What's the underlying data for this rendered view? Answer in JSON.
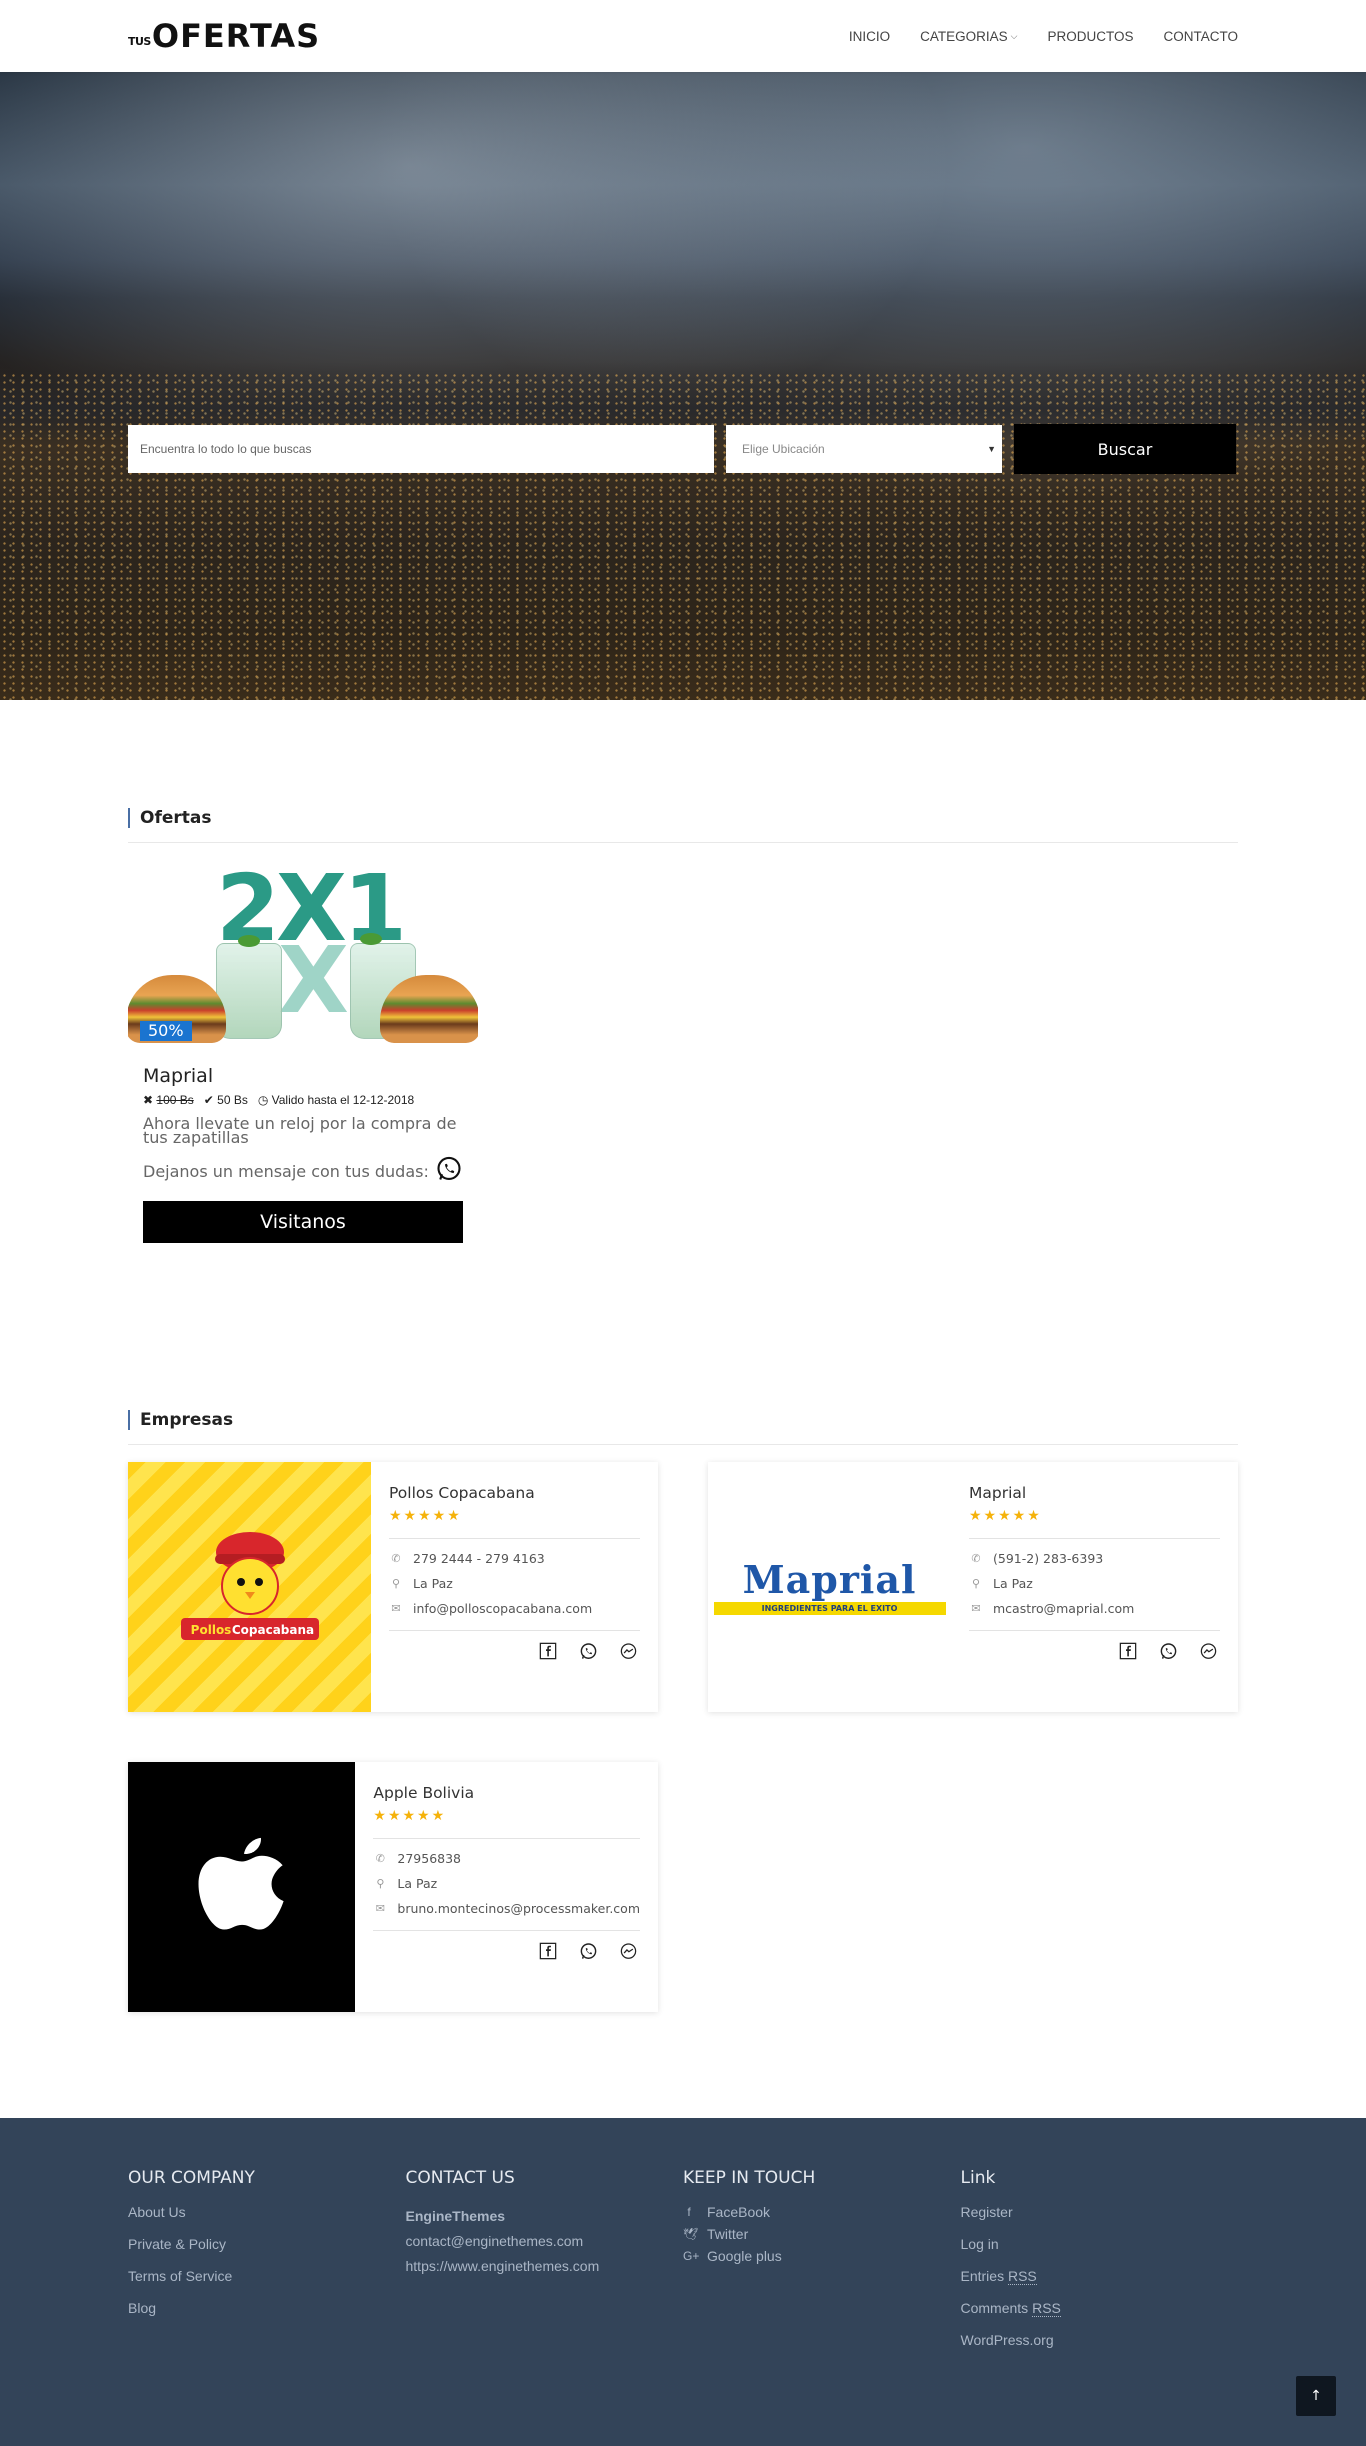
{
  "header": {
    "logo_small": "TUS",
    "logo_big": "OFERTAS",
    "nav": [
      "INICIO",
      "CATEGORIAS",
      "PRODUCTOS",
      "CONTACTO"
    ]
  },
  "search": {
    "placeholder": "Encuentra lo todo lo que buscas",
    "location_placeholder": "Elige Ubicación",
    "button": "Buscar"
  },
  "offers": {
    "title": "Ofertas",
    "items": [
      {
        "image_text": "2X1",
        "discount": "50%",
        "name": "Maprial",
        "old_price": "100 Bs",
        "new_price": "50 Bs",
        "valid": "Valido hasta el 12-12-2018",
        "description": "Ahora llevate un reloj por la compra de tus zapatillas",
        "message": "Dejanos un mensaje con tus dudas:",
        "button": "Visitanos"
      }
    ]
  },
  "companies": {
    "title": "Empresas",
    "items": [
      {
        "name": "Pollos Copacabana",
        "stars": "★★★★★",
        "phone": "279 2444 - 279 4163",
        "location": "La Paz",
        "email": "info@polloscopacabana.com",
        "logo_text": [
          "Pollos",
          "Copacabana"
        ]
      },
      {
        "name": "Maprial",
        "stars": "★★★★★",
        "phone": "(591-2) 283-6393",
        "location": "La Paz",
        "email": "mcastro@maprial.com",
        "logo_text": [
          "Maprial",
          "INGREDIENTES PARA EL EXITO"
        ]
      },
      {
        "name": "Apple Bolivia",
        "stars": "★★★★★",
        "phone": "27956838",
        "location": "La Paz",
        "email": "bruno.montecinos@processmaker.com"
      }
    ]
  },
  "footer": {
    "company": {
      "title": "OUR COMPANY",
      "links": [
        "About Us",
        "Private & Policy",
        "Terms of Service",
        "Blog"
      ]
    },
    "contact": {
      "title": "CONTACT US",
      "name": "EngineThemes",
      "email": "contact@enginethemes.com",
      "url": "https://www.enginethemes.com"
    },
    "touch": {
      "title": "KEEP IN TOUCH",
      "links": [
        "FaceBook",
        "Twitter",
        "Google plus"
      ]
    },
    "link": {
      "title": "Link",
      "register": "Register",
      "login": "Log in",
      "entries": "Entries",
      "comments": "Comments",
      "rss": "RSS",
      "wordpress": "WordPress.org"
    }
  },
  "colors": {
    "accent": "#1a74d0",
    "star": "#f5b20a",
    "footer_bg": "#334459"
  }
}
